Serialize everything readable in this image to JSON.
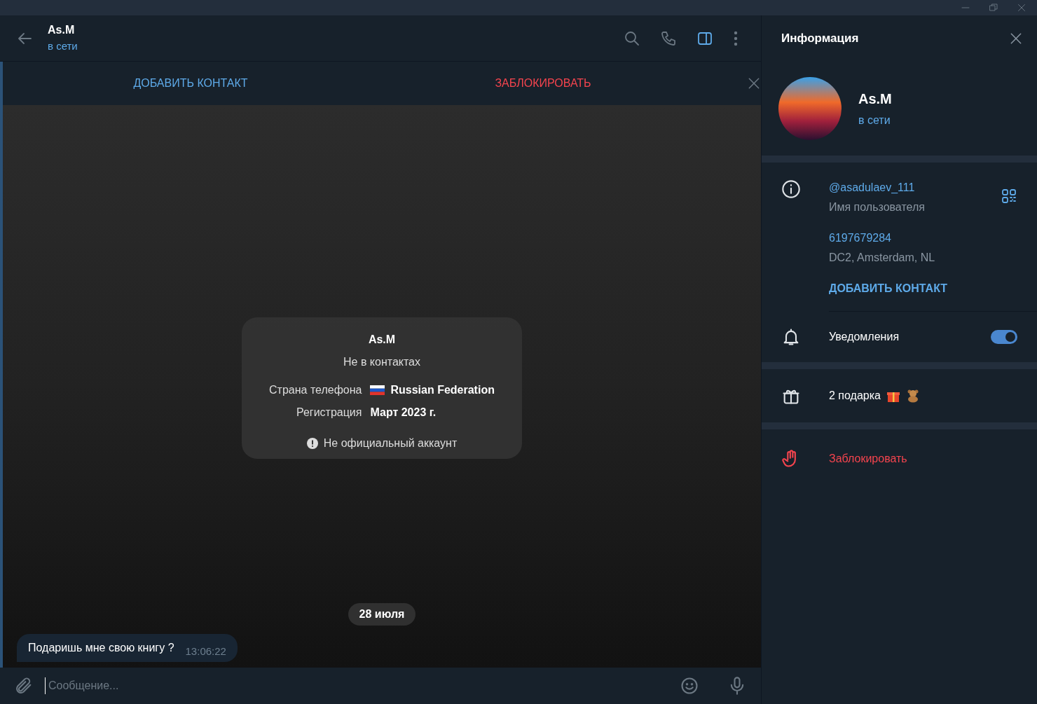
{
  "chat_header": {
    "name": "As.M",
    "status": "в сети"
  },
  "action_bar": {
    "add_contact": "ДОБАВИТЬ КОНТАКТ",
    "block": "ЗАБЛОКИРОВАТЬ"
  },
  "info_card": {
    "name": "As.M",
    "subtitle": "Не в контактах",
    "rows": [
      {
        "label": "Страна телефона",
        "value": "Russian Federation",
        "flag": true
      },
      {
        "label": "Регистрация",
        "value": "Март 2023 г.",
        "flag": false
      }
    ],
    "note": "Не официальный аккаунт"
  },
  "date_badge": "28 июля",
  "messages": [
    {
      "text": "Подаришь мне свою книгу ?",
      "time": "13:06:22"
    }
  ],
  "composer": {
    "placeholder": "Сообщение..."
  },
  "info_panel": {
    "title": "Информация",
    "name": "As.M",
    "status": "в сети",
    "username": "@asadulaev_111",
    "username_label": "Имя пользователя",
    "id": "6197679284",
    "dc": "DC2, Amsterdam, NL",
    "add_contact": "ДОБАВИТЬ КОНТАКТ",
    "notifications": {
      "label": "Уведомления",
      "on": true
    },
    "gifts": "2 подарка",
    "block": "Заблокировать"
  }
}
